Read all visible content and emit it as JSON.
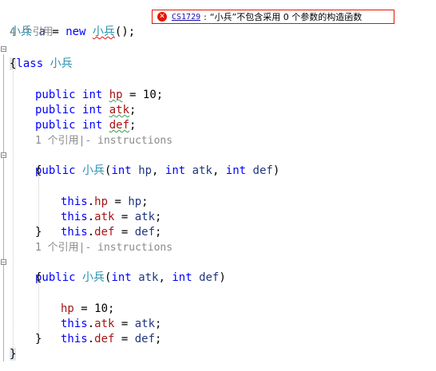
{
  "line1": {
    "type": "小兵",
    "var": "a",
    "eq": "=",
    "new_kw": "new",
    "ctor": "小兵",
    "tail": "();"
  },
  "error": {
    "icon": "error-icon",
    "code": "CS1729",
    "sep": ":",
    "message": "“小兵”不包含采用 0 个参数的构造函数"
  },
  "class_refs": "4 个引用",
  "class_kw": "class",
  "class_name": "小兵",
  "open_brace": "{",
  "close_brace": "}",
  "fields": [
    {
      "kw1": "public",
      "kw2": "int",
      "name": "hp",
      "rest": " = 10;"
    },
    {
      "kw1": "public",
      "kw2": "int",
      "name": "atk",
      "rest": ";"
    },
    {
      "kw1": "public",
      "kw2": "int",
      "name": "def",
      "rest": ";"
    }
  ],
  "ctor1": {
    "lens": "1 个引用|- instructions",
    "public": "public",
    "name": "小兵",
    "params": "(int hp, int atk, int def)",
    "p_open": "(",
    "p_int1": "int",
    "p_hp": "hp",
    "p_c1": ", ",
    "p_int2": "int",
    "p_atk": "atk",
    "p_c2": ", ",
    "p_int3": "int",
    "p_def": "def",
    "p_close": ")",
    "stmts": [
      {
        "this": "this",
        "dot": ".",
        "field": "hp",
        "mid": " = ",
        "param": "hp",
        "end": ";"
      },
      {
        "this": "this",
        "dot": ".",
        "field": "atk",
        "mid": " = ",
        "param": "atk",
        "end": ";"
      },
      {
        "this": "this",
        "dot": ".",
        "field": "def",
        "mid": " = ",
        "param": "def",
        "end": ";"
      }
    ]
  },
  "ctor2": {
    "lens": "1 个引用|- instructions",
    "public": "public",
    "name": "小兵",
    "p_open": "(",
    "p_int1": "int",
    "p_atk": "atk",
    "p_c1": ", ",
    "p_int2": "int",
    "p_def": "def",
    "p_close": ")",
    "stmt0": {
      "field": "hp",
      "rest": " = 10;"
    },
    "stmts": [
      {
        "this": "this",
        "dot": ".",
        "field": "atk",
        "mid": " = ",
        "param": "atk",
        "end": ";"
      },
      {
        "this": "this",
        "dot": ".",
        "field": "def",
        "mid": " = ",
        "param": "def",
        "end": ";"
      }
    ]
  }
}
